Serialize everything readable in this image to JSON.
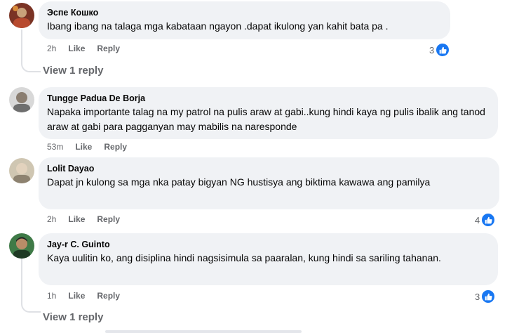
{
  "comments": [
    {
      "author": "Эспе Кошко",
      "text": "Ibang ibang na talaga mga kabataan ngayon .dapat ikulong yan kahit bata pa .",
      "time": "2h",
      "like_label": "Like",
      "reply_label": "Reply",
      "reaction_count": "3",
      "view_replies": "View 1 reply",
      "avatar_color": "#8b3a2b"
    },
    {
      "author": "Tungge Padua De Borja",
      "text": "Napaka importante talag na my patrol na pulis araw at gabi..kung hindi kaya ng pulis ibalik ang tanod araw at gabi para pagganyan may mabilis na naresponde",
      "time": "53m",
      "like_label": "Like",
      "reply_label": "Reply",
      "avatar_color": "#9c9c9c"
    },
    {
      "author": "Lolit Dayao",
      "text": "Dapat jn kulong sa mga nka patay bigyan NG hustisya ang biktima kawawa ang pamilya",
      "time": "2h",
      "like_label": "Like",
      "reply_label": "Reply",
      "reaction_count": "4",
      "avatar_color": "#a49a82"
    },
    {
      "author": "Jay-r C. Guinto",
      "text": "Kaya uulitin ko, ang disiplina hindi nagsisimula sa paaralan, kung hindi sa sariling tahanan.",
      "time": "1h",
      "like_label": "Like",
      "reply_label": "Reply",
      "reaction_count": "3",
      "view_replies": "View 1 reply",
      "avatar_color": "#2f6b3a"
    }
  ],
  "icons": {
    "reaction": "thumbs-up-icon"
  },
  "colors": {
    "bubble": "#f0f2f5",
    "meta": "#65676b",
    "like_blue": "#1877f2"
  }
}
